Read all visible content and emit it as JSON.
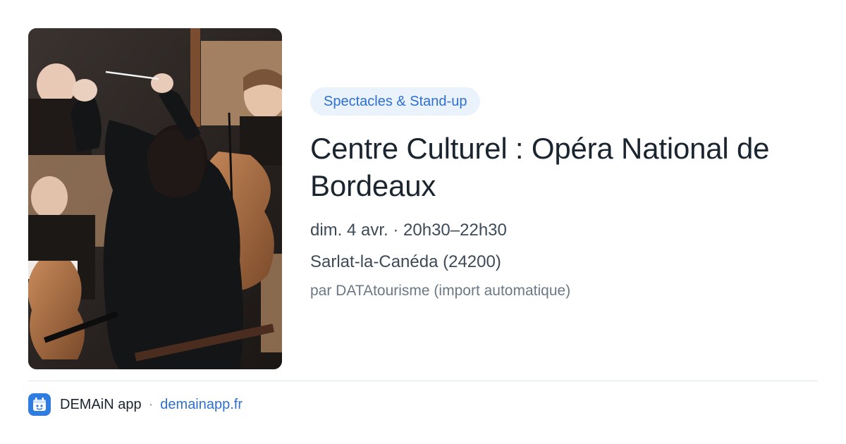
{
  "event": {
    "category": "Spectacles & Stand-up",
    "title": "Centre Culturel : Opéra National de Bordeaux",
    "datetime": "dim. 4 avr. · 20h30–22h30",
    "location": "Sarlat-la-Canéda (24200)",
    "source": "par DATAtourisme (import automatique)",
    "image": {
      "icon": "orchestra-conductor-photo"
    }
  },
  "footer": {
    "app_name": "DEMAiN app",
    "separator": "·",
    "link": "demainapp.fr",
    "icon": "demain-app-logo-icon"
  },
  "colors": {
    "tag_bg": "#eaf2fc",
    "tag_text": "#2f6fd0",
    "title": "#1a2530",
    "link": "#2f6fd0",
    "app_icon": "#2f7de1"
  }
}
